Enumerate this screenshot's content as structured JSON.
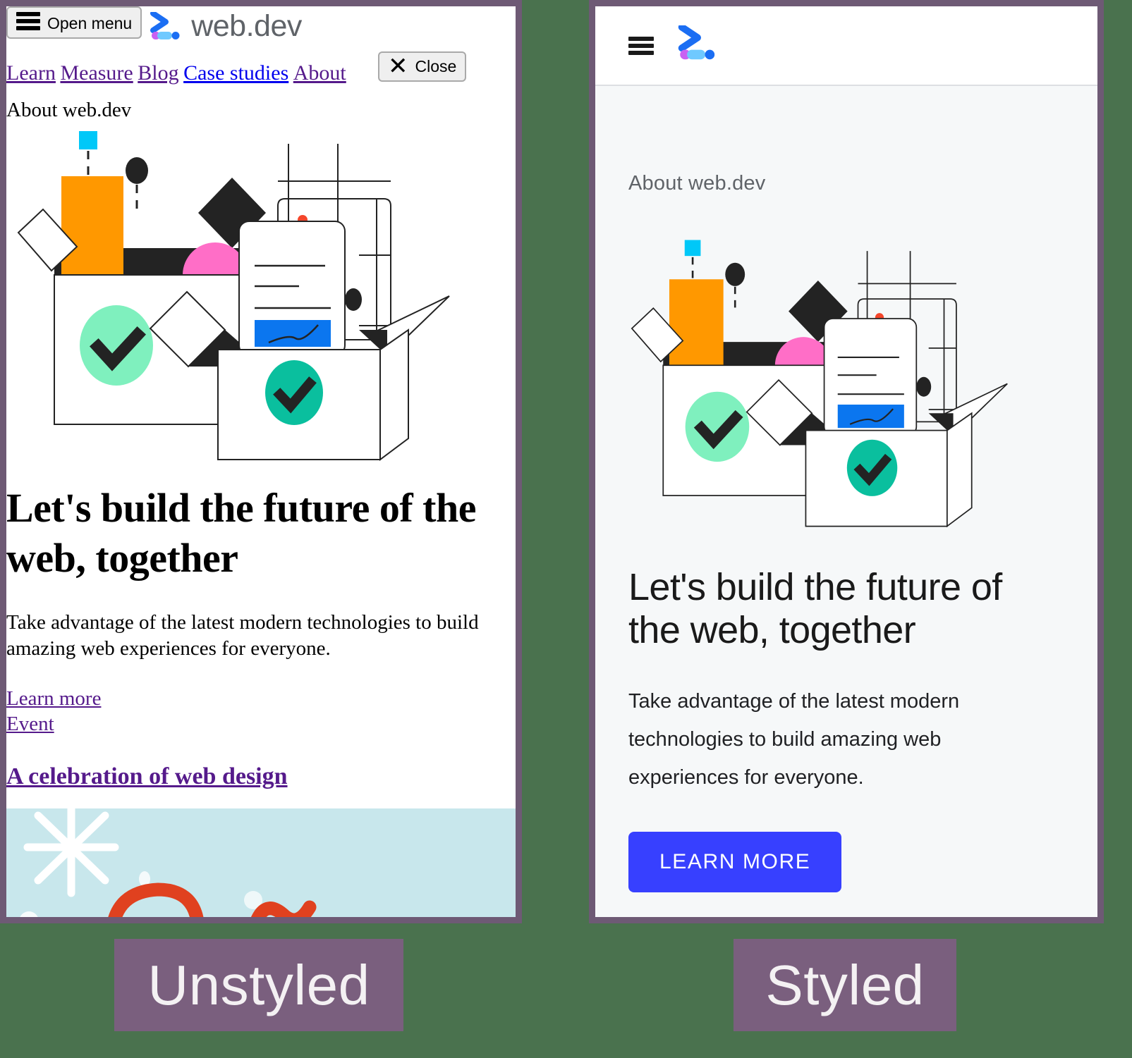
{
  "page": {
    "background_color": "#4a724e",
    "panel_border_color": "#6e5a75"
  },
  "captions": {
    "unstyled": "Unstyled",
    "styled": "Styled",
    "background_color": "#7a5f7e",
    "text_color": "#f4f1f3"
  },
  "unstyled_panel": {
    "open_menu_button": "Open menu",
    "open_menu_icon": "hamburger-icon",
    "logo_text": "web.dev",
    "logo_icon": "webdev-logo-icon",
    "nav_links": [
      {
        "label": "Learn",
        "state": "visited",
        "color": "#551a8b"
      },
      {
        "label": "Measure",
        "state": "visited",
        "color": "#551a8b"
      },
      {
        "label": "Blog",
        "state": "visited",
        "color": "#551a8b"
      },
      {
        "label": "Case studies",
        "state": "unvisited",
        "color": "#0000ee"
      },
      {
        "label": "About",
        "state": "visited",
        "color": "#551a8b"
      }
    ],
    "close_button": "Close",
    "close_icon": "close-x-icon",
    "eyebrow": "About web.dev",
    "heading": "Let's build the future of the web, together",
    "paragraph": "Take advantage of the latest modern technologies to build amazing web experiences for everyone.",
    "links": [
      {
        "label": "Learn more"
      },
      {
        "label": "Event"
      }
    ],
    "promo_heading": "A celebration of web design",
    "promo_image_alt": "snowflake-holiday-banner"
  },
  "styled_panel": {
    "menu_icon": "hamburger-icon",
    "logo_icon": "webdev-logo-icon",
    "eyebrow": "About web.dev",
    "heading": "Let's build the future of the web, together",
    "paragraph": "Take advantage of the latest modern technologies to build amazing web experiences for everyone.",
    "cta_label": "LEARN MORE",
    "cta_color": "#3740ff",
    "header_background": "#ffffff",
    "body_background": "#f6f8f9"
  },
  "illustration": {
    "name": "open-box-with-shapes-illustration",
    "colors": {
      "orange": "#ff9800",
      "pink": "#ff6ec7",
      "cyan": "#00c8f8",
      "mint": "#7ff0be",
      "teal": "#0abf9e",
      "blue": "#0b76ef",
      "dark": "#232323",
      "red_dot": "#f4462b"
    }
  }
}
